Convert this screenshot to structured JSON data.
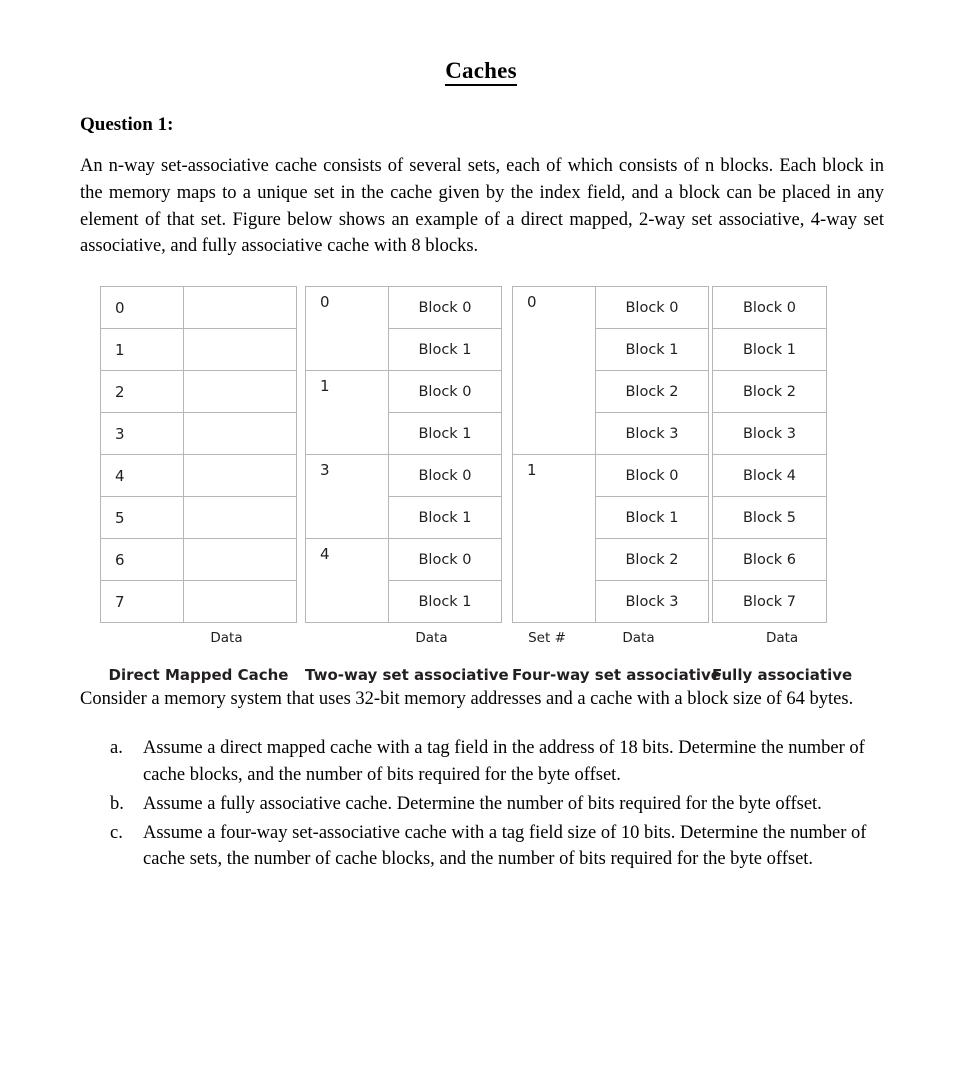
{
  "document": {
    "title": "Caches",
    "question_heading": "Question 1:",
    "intro_paragraph": "An n-way set-associative cache consists of several sets, each of which consists of n blocks. Each block in the memory maps to a unique set in the cache given by the index field, and a block can be placed in any element of that set. Figure below shows an example of a direct mapped, 2-way set associative, 4-way set associative, and fully associative cache with 8 blocks.",
    "consider_paragraph": "Consider a memory system that uses 32-bit memory addresses and a cache with a block size of 64 bytes.",
    "sub_questions": [
      {
        "marker": "a.",
        "text": "Assume a direct mapped cache with a tag field in the address of 18 bits. Determine the number of cache blocks, and the number of bits required for the byte offset."
      },
      {
        "marker": "b.",
        "text": "Assume a fully associative cache. Determine the number of bits required for the byte offset."
      },
      {
        "marker": "c.",
        "text": "Assume a four-way set-associative cache with a tag field size of 10 bits. Determine the number of cache sets, the number of cache blocks, and the number of bits required for the byte offset."
      }
    ]
  },
  "figure": {
    "direct_mapped": {
      "caption": "Direct Mapped Cache",
      "data_label": "Data",
      "indices": [
        "0",
        "1",
        "2",
        "3",
        "4",
        "5",
        "6",
        "7"
      ],
      "blocks": [
        "",
        "",
        "",
        "",
        "",
        "",
        "",
        ""
      ]
    },
    "two_way": {
      "caption": "Two-way set associative",
      "data_label": "Data",
      "sets": [
        {
          "index": "0",
          "blocks": [
            "Block 0",
            "Block 1"
          ]
        },
        {
          "index": "1",
          "blocks": [
            "Block 0",
            "Block 1"
          ]
        },
        {
          "index": "3",
          "blocks": [
            "Block 0",
            "Block 1"
          ]
        },
        {
          "index": "4",
          "blocks": [
            "Block 0",
            "Block 1"
          ]
        }
      ]
    },
    "four_way": {
      "caption": "Four-way set associative",
      "data_label": "Data",
      "set_label": "Set #",
      "sets": [
        {
          "index": "0",
          "blocks": [
            "Block 0",
            "Block 1",
            "Block 2",
            "Block 3"
          ]
        },
        {
          "index": "1",
          "blocks": [
            "Block 0",
            "Block 1",
            "Block 2",
            "Block 3"
          ]
        }
      ]
    },
    "fully_associative": {
      "caption": "Fully associative",
      "data_label": "Data",
      "blocks": [
        "Block 0",
        "Block 1",
        "Block 2",
        "Block 3",
        "Block 4",
        "Block 5",
        "Block 6",
        "Block 7"
      ]
    }
  }
}
